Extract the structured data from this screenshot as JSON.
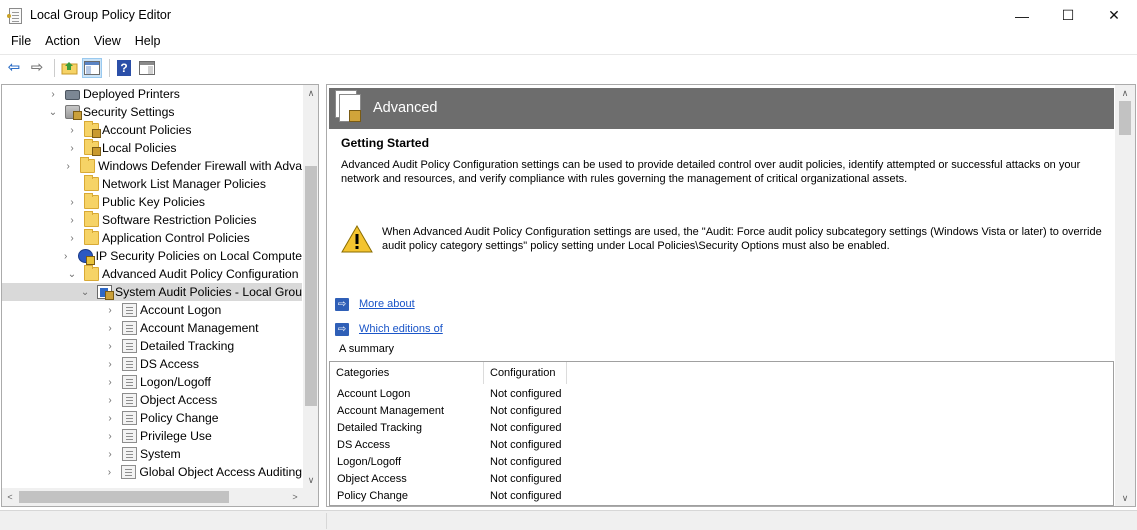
{
  "window": {
    "title": "Local Group Policy Editor",
    "minimize_glyph": "—",
    "maximize_glyph": "☐",
    "close_glyph": "✕"
  },
  "menu": [
    {
      "label": "File"
    },
    {
      "label": "Action"
    },
    {
      "label": "View"
    },
    {
      "label": "Help"
    }
  ],
  "toolbar": {
    "back_glyph": "⇦",
    "forward_glyph": "⇨",
    "help_glyph": "?"
  },
  "tree": {
    "twisty_collapsed": "›",
    "twisty_expanded": "⌄",
    "items": [
      {
        "label": "Deployed Printers",
        "icon": "printer"
      },
      {
        "label": "Security Settings",
        "icon": "security-settings"
      },
      {
        "label": "Account Policies",
        "icon": "lock-folder"
      },
      {
        "label": "Local Policies",
        "icon": "lock-folder"
      },
      {
        "label": "Windows Defender Firewall with Adva",
        "icon": "folder"
      },
      {
        "label": "Network List Manager Policies",
        "icon": "folder"
      },
      {
        "label": "Public Key Policies",
        "icon": "folder"
      },
      {
        "label": "Software Restriction Policies",
        "icon": "folder"
      },
      {
        "label": "Application Control Policies",
        "icon": "folder"
      },
      {
        "label": "IP Security Policies on Local Compute",
        "icon": "ipsec"
      },
      {
        "label": "Advanced Audit Policy Configuration",
        "icon": "folder"
      },
      {
        "label": "System Audit Policies - Local Grou",
        "icon": "system-audit-policies"
      },
      {
        "label": "Account Logon",
        "icon": "policy"
      },
      {
        "label": "Account Management",
        "icon": "policy"
      },
      {
        "label": "Detailed Tracking",
        "icon": "policy"
      },
      {
        "label": "DS Access",
        "icon": "policy"
      },
      {
        "label": "Logon/Logoff",
        "icon": "policy"
      },
      {
        "label": "Object Access",
        "icon": "policy"
      },
      {
        "label": "Policy Change",
        "icon": "policy"
      },
      {
        "label": "Privilege Use",
        "icon": "policy"
      },
      {
        "label": "System",
        "icon": "policy"
      },
      {
        "label": "Global Object Access Auditing",
        "icon": "policy"
      }
    ],
    "scroll_up": "∧",
    "scroll_down": "∨",
    "scroll_left": "<",
    "scroll_right": ">"
  },
  "details": {
    "header_title": "Advanced",
    "getting_started_title": "Getting Started",
    "intro_text": "Advanced Audit Policy Configuration settings can be used to provide detailed control over audit policies, identify attempted or successful attacks on your network and resources, and verify compliance with rules governing the management of critical organizational assets.",
    "warning_text": "When Advanced Audit Policy Configuration settings are used, the \"Audit: Force audit policy subcategory settings (Windows Vista or later) to override audit policy category settings\" policy setting under Local Policies\\Security Options must also be enabled.",
    "link_arrow": "⇨",
    "links": [
      {
        "label": "More about"
      },
      {
        "label": "Which editions of"
      }
    ],
    "summary_label": "A summary",
    "summary_columns": [
      "Categories",
      "Configuration"
    ],
    "summary_rows": [
      {
        "category": "Account Logon",
        "configuration": "Not configured"
      },
      {
        "category": "Account Management",
        "configuration": "Not configured"
      },
      {
        "category": "Detailed Tracking",
        "configuration": "Not configured"
      },
      {
        "category": "DS Access",
        "configuration": "Not configured"
      },
      {
        "category": "Logon/Logoff",
        "configuration": "Not configured"
      },
      {
        "category": "Object Access",
        "configuration": "Not configured"
      },
      {
        "category": "Policy Change",
        "configuration": "Not configured"
      }
    ]
  }
}
